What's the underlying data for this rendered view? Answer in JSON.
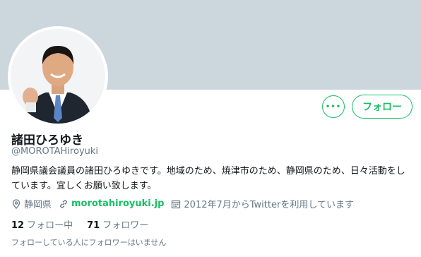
{
  "profile": {
    "name": "諸田ひろゆき",
    "handle": "@MOROTAHiroyuki",
    "bio": "静岡県議会議員の諸田ひろゆきです。地域のため、焼津市のため、静岡県のため、日々活動をしています。宜しくお願い致します。",
    "location": "静岡県",
    "website": "morotahiroyuki.jp",
    "joined": "2012年7月からTwitterを利用しています"
  },
  "actions": {
    "more_label": "•••",
    "follow_label": "フォロー"
  },
  "stats": {
    "following_count": "12",
    "following_label": "フォロー中",
    "followers_count": "71",
    "followers_label": "フォロワー"
  },
  "note": "フォローしている人にフォロワーはいません",
  "icons": [
    "location-icon",
    "link-icon",
    "calendar-icon",
    "more-icon"
  ],
  "colors": {
    "banner": "#ccd6dd",
    "accent": "#17bf63",
    "secondary_text": "#657786",
    "primary_text": "#14171a"
  }
}
